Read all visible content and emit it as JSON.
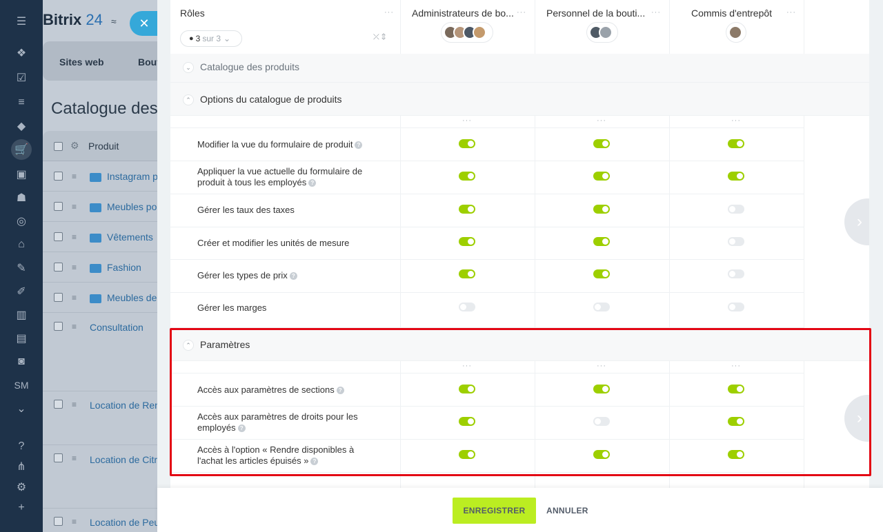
{
  "app": {
    "logo_text": "Bitrix",
    "logo_num": "24",
    "sm_label": "SM"
  },
  "background": {
    "tabs": [
      "Sites web",
      "Bout"
    ],
    "title": "Catalogue des",
    "table_header": "Produit",
    "rows": [
      {
        "name": "Instagram p",
        "folder": true
      },
      {
        "name": "Meubles po",
        "folder": true
      },
      {
        "name": "Vêtements",
        "folder": true
      },
      {
        "name": "Fashion",
        "folder": true
      },
      {
        "name": "Meubles de",
        "folder": true
      },
      {
        "name": "Consultation",
        "folder": false
      },
      {
        "name": "Location de Ren",
        "folder": false
      },
      {
        "name": "Location de Citr",
        "folder": false
      },
      {
        "name": "Location de Peu",
        "folder": false
      }
    ]
  },
  "header": {
    "roles_label": "Rôles",
    "filter_count": "3",
    "filter_total": "sur 3",
    "columns": [
      {
        "title": "Administrateurs de bo..."
      },
      {
        "title": "Personnel de la bouti..."
      },
      {
        "title": "Commis d'entrepôt"
      }
    ]
  },
  "sections": {
    "catalogue": "Catalogue des produits",
    "options": "Options du catalogue de produits",
    "parametres": "Paramètres"
  },
  "options_rows": [
    {
      "label": "Modifier la vue du formulaire de produit",
      "help": true,
      "values": [
        true,
        true,
        true
      ]
    },
    {
      "label": "Appliquer la vue actuelle du formulaire de produit à tous les employés",
      "help": true,
      "values": [
        true,
        true,
        true
      ]
    },
    {
      "label": "Gérer les taux des taxes",
      "help": false,
      "values": [
        true,
        true,
        false
      ]
    },
    {
      "label": "Créer et modifier les unités de mesure",
      "help": false,
      "values": [
        true,
        true,
        false
      ]
    },
    {
      "label": "Gérer les types de prix",
      "help": true,
      "values": [
        true,
        true,
        false
      ]
    },
    {
      "label": "Gérer les marges",
      "help": false,
      "values": [
        false,
        false,
        false
      ]
    }
  ],
  "parametres_rows": [
    {
      "label": "Accès aux paramètres de sections",
      "help": true,
      "values": [
        true,
        true,
        true
      ]
    },
    {
      "label": "Accès aux paramètres de droits pour les employés",
      "help": true,
      "values": [
        true,
        false,
        true
      ]
    },
    {
      "label": "Accès à l'option « Rendre disponibles à l'achat les articles épuisés »",
      "help": true,
      "values": [
        true,
        true,
        true
      ]
    }
  ],
  "footer": {
    "save_label": "ENREGISTRER",
    "cancel_label": "ANNULER"
  },
  "colors": {
    "toggle_on": "#9dcf00",
    "save_button": "#bbed21",
    "highlight": "#e30613"
  }
}
